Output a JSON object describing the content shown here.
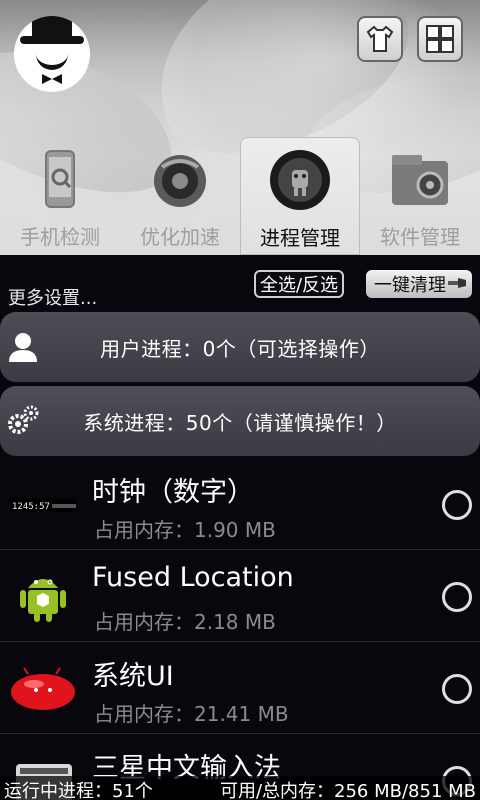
{
  "tabs": [
    {
      "label": "手机检测",
      "icon": "phone-check-icon",
      "active": false
    },
    {
      "label": "优化加速",
      "icon": "speed-optimize-icon",
      "active": false
    },
    {
      "label": "进程管理",
      "icon": "process-manager-icon",
      "active": true
    },
    {
      "label": "软件管理",
      "icon": "software-manager-icon",
      "active": false
    }
  ],
  "toolbar": {
    "more_settings": "更多设置...",
    "select_invert": "全选/反选",
    "one_key_clean": "一键清理"
  },
  "groups": {
    "user": "用户进程：0个（可选择操作）",
    "system": "系统进程：50个（请谨慎操作！）"
  },
  "processes": [
    {
      "name": "时钟（数字）",
      "memory": "占用内存：1.90 MB",
      "icon": "clock-digital-icon"
    },
    {
      "name": "Fused Location",
      "memory": "占用内存：2.18 MB",
      "icon": "android-robot-icon"
    },
    {
      "name": "系统UI",
      "memory": "占用内存：21.41 MB",
      "icon": "jelly-bean-icon"
    },
    {
      "name": "三星中文输入法",
      "memory": "",
      "icon": "keyboard-icon"
    }
  ],
  "status": {
    "running": "运行中进程：51个",
    "memory": "可用/总内存：256 MB/851 MB"
  },
  "colors": {
    "background": "#07070d",
    "group_bar": "#46464e",
    "secondary_text": "#8b8b8b"
  }
}
